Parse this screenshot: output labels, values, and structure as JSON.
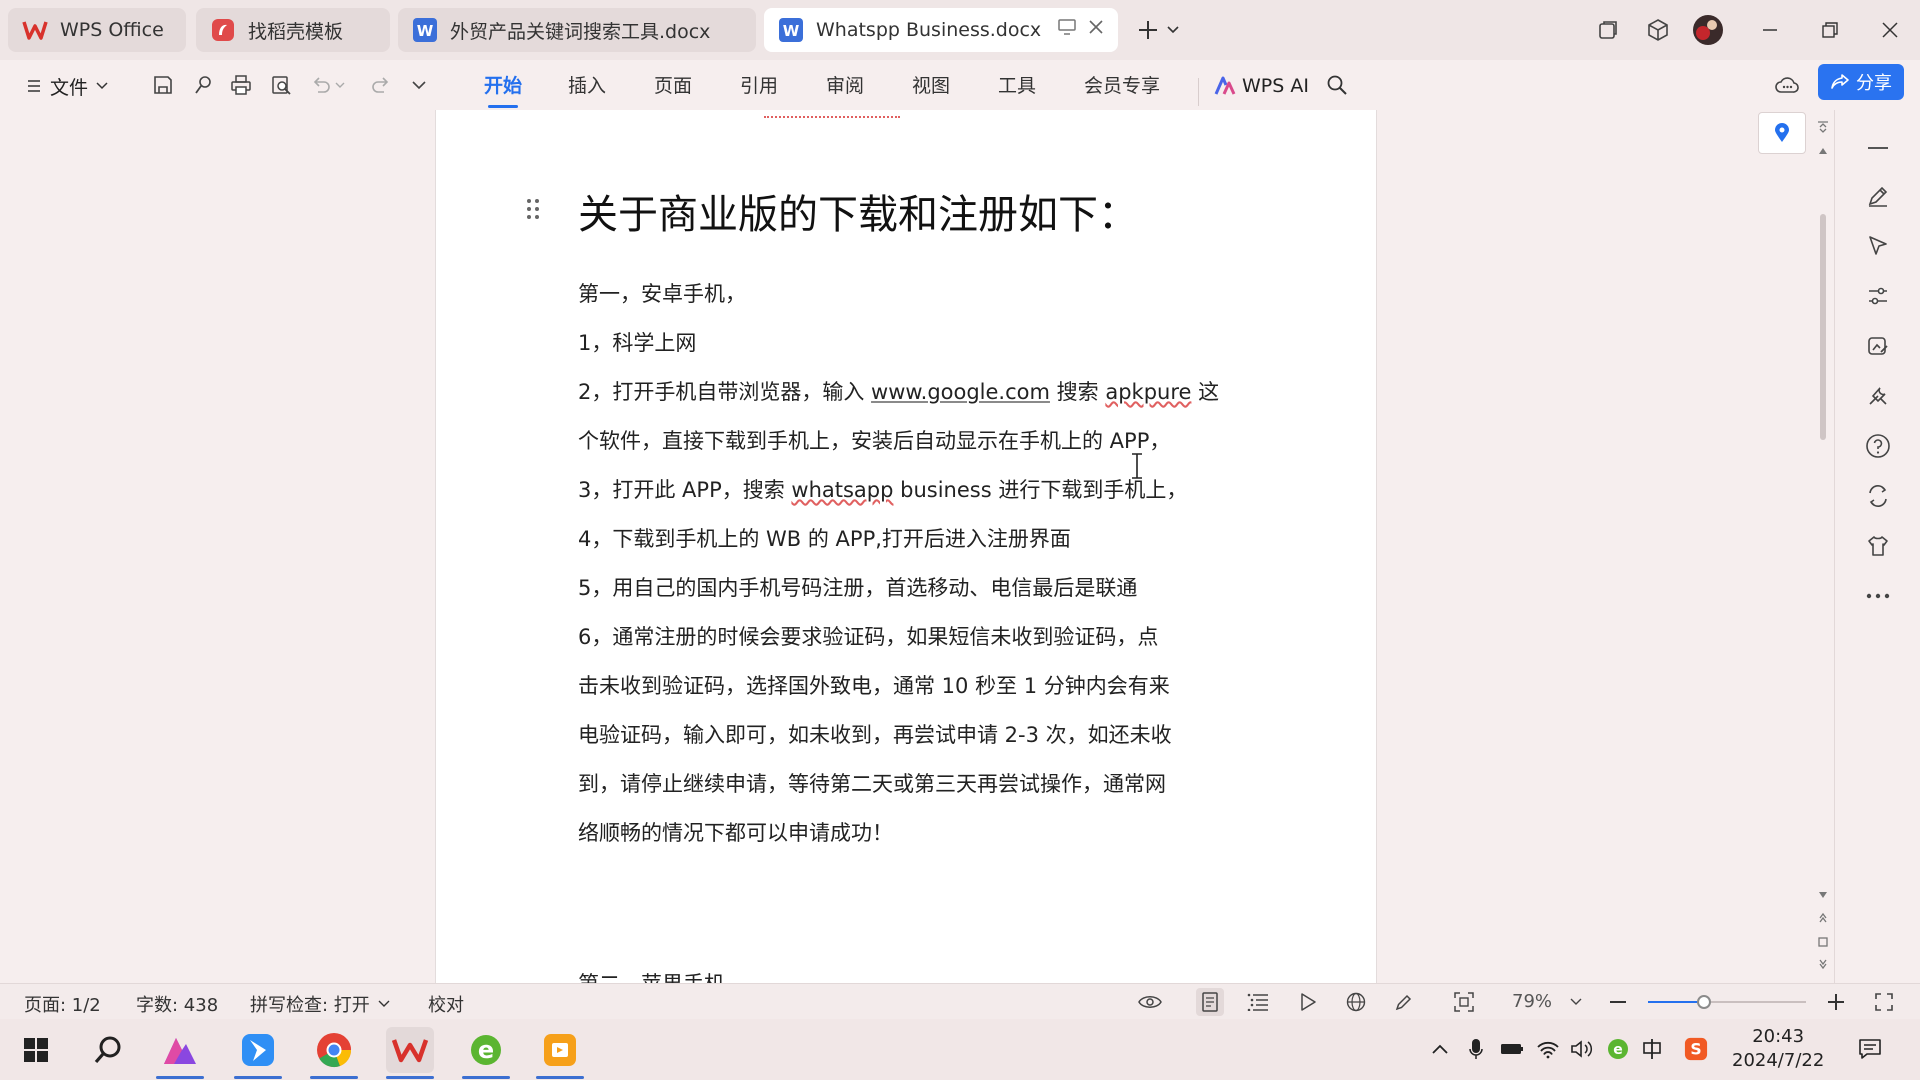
{
  "tabs": [
    {
      "label": "WPS Office"
    },
    {
      "label": "找稻壳模板"
    },
    {
      "label": "外贸产品关键词搜索工具.docx"
    },
    {
      "label": "Whatspp Business.docx"
    }
  ],
  "toolbar": {
    "file_label": "文件",
    "menu": [
      "开始",
      "插入",
      "页面",
      "引用",
      "审阅",
      "视图",
      "工具",
      "会员专享"
    ],
    "wps_ai_label": "WPS AI",
    "share_label": "分享"
  },
  "document": {
    "heading": "关于商业版的下载和注册如下：",
    "lines": [
      "第一，安卓手机，",
      "1，科学上网",
      {
        "a": "2，打开手机自带浏览器，输入 ",
        "url": "www.google.com",
        "b": " 搜索 ",
        "c": "apkpure",
        "d": " 这"
      },
      "个软件，直接下载到手机上，安装后自动显示在手机上的 APP，",
      {
        "a": "3，打开此 APP，搜索 ",
        "w": "whatsapp",
        "b": " business 进行下载到手机上，"
      },
      "4，下载到手机上的 WB 的 APP,打开后进入注册界面",
      "5，用自己的国内手机号码注册，首选移动、电信最后是联通",
      "6，通常注册的时候会要求验证码，如果短信未收到验证码，点",
      "击未收到验证码，选择国外致电，通常 10 秒至 1 分钟内会有来",
      "电验证码，输入即可，如未收到，再尝试申请 2-3 次，如还未收",
      "到，请停止继续申请，等待第二天或第三天再尝试操作，通常网",
      "络顺畅的情况下都可以申请成功！"
    ],
    "next_section_partial": "第二，苹果手机"
  },
  "status": {
    "page": "页面: 1/2",
    "words": "字数: 438",
    "spell": "拼写检查: 打开",
    "proof": "校对",
    "zoom": "79%"
  },
  "clock": {
    "time": "20:43",
    "date": "2024/7/22"
  },
  "colors": {
    "accent": "#2470ee",
    "wps_red": "#d8322c"
  }
}
